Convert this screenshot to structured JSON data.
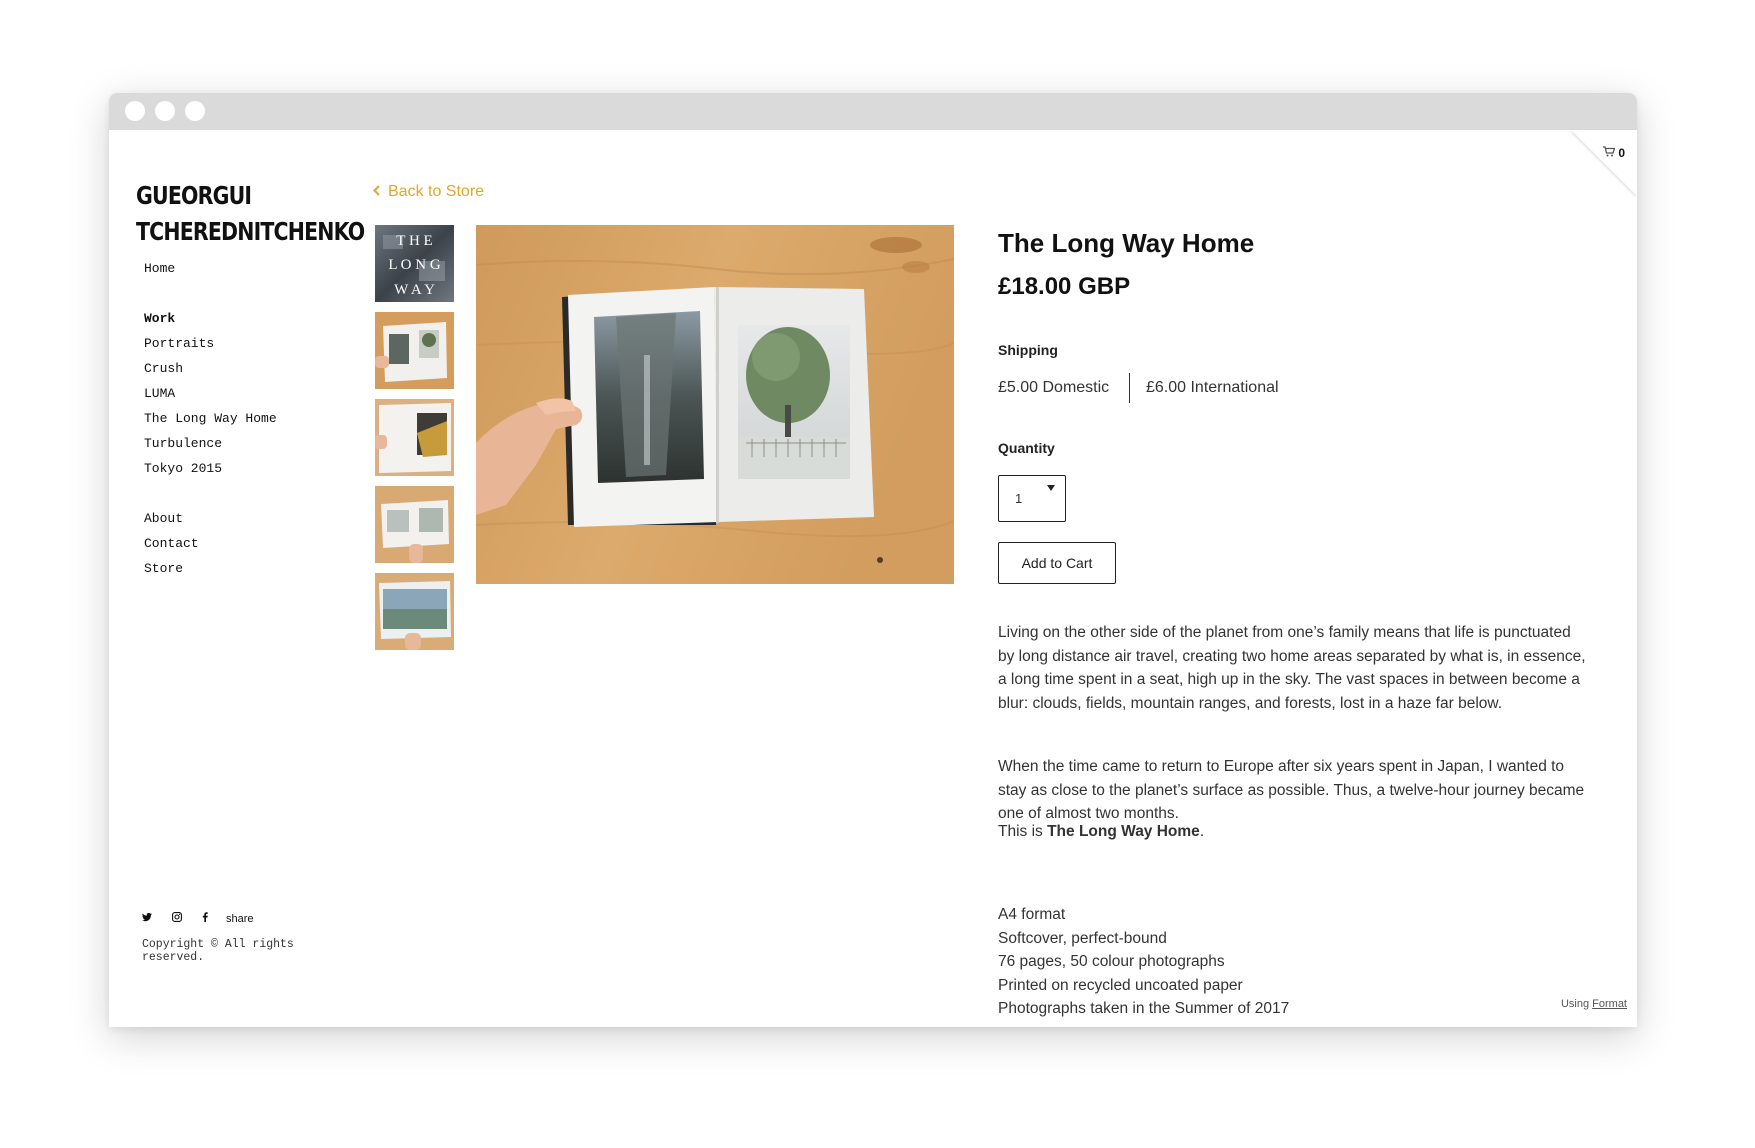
{
  "site": {
    "brand_line1": "GUEORGUI",
    "brand_line2": "TCHEREDNITCHENKO"
  },
  "nav": {
    "home": "Home",
    "work": "Work",
    "portraits": "Portraits",
    "crush": "Crush",
    "luma": "LUMA",
    "long_way_home": "The Long Way Home",
    "turbulence": "Turbulence",
    "tokyo": "Tokyo 2015",
    "about": "About",
    "contact": "Contact",
    "store": "Store"
  },
  "social": {
    "twitter_icon": "twitter-icon",
    "instagram_icon": "instagram-icon",
    "facebook_icon": "facebook-icon",
    "share_label": "share"
  },
  "footer": {
    "copyright": "Copyright © All rights reserved.",
    "using_label": "Using",
    "using_link": "Format"
  },
  "cart": {
    "count": "0",
    "icon": "cart-icon"
  },
  "back_link": "Back to Store",
  "thumbnail_text": {
    "row1": "T H E",
    "row2": "L O N G",
    "row3": "W A Y"
  },
  "product": {
    "title": "The Long Way Home",
    "price": "£18.00 GBP",
    "shipping_label": "Shipping",
    "shipping_domestic": "£5.00 Domestic",
    "shipping_international": "£6.00 International",
    "quantity_label": "Quantity",
    "quantity_value": "1",
    "add_to_cart": "Add to Cart",
    "description_p1": "Living on the other side of the planet from one’s family means that life is punctuated by long distance air travel, creating two home areas separated by what is, in essence, a long time spent in a seat, high up in the sky. The vast spaces in between become a blur: clouds, fields, mountain ranges, and forests, lost in a haze far below.",
    "description_p2": "When the time came to return to Europe after six years spent in Japan, I wanted to stay as close to the planet’s surface as possible. Thus, a twelve-hour journey became one of almost two months.",
    "description_p3_prefix": "This is ",
    "description_p3_bold": "The Long Way Home",
    "description_p3_suffix": ".",
    "specs": [
      "A4 format",
      "Softcover, perfect-bound",
      "76 pages, 50 colour photographs",
      "Printed on recycled uncoated paper",
      "Photographs taken in the Summer of 2017"
    ]
  },
  "colors": {
    "accent": "#e2a628",
    "window_bar": "#dadada",
    "wood": "#d9a464"
  }
}
